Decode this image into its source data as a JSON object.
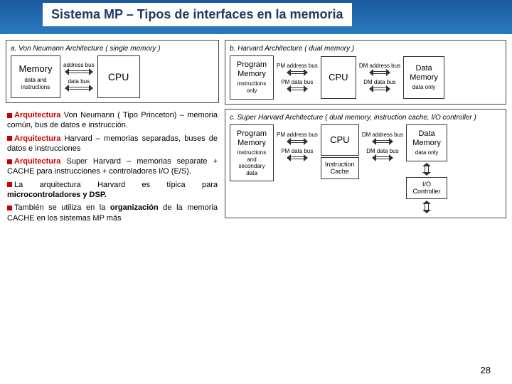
{
  "title": "Sistema MP  – Tipos de interfaces en la memoria",
  "diagA": {
    "label": "a.  Von Neumann Architecture  ( single memory )",
    "memory": "Memory",
    "memory_sub": "data and instructions",
    "cpu": "CPU",
    "bus1": "address bus",
    "bus2": "data bus"
  },
  "diagB": {
    "label": "b.  Harvard Architecture  ( dual memory )",
    "pmem": "Program Memory",
    "pmem_sub": "instructions only",
    "cpu": "CPU",
    "dmem": "Data Memory",
    "dmem_sub": "data only",
    "pm_addr": "PM address bus",
    "pm_data": "PM data bus",
    "dm_addr": "DM address bus",
    "dm_data": "DM data bus"
  },
  "diagC": {
    "label": "c.  Super Harvard Architecture  ( dual memory, instruction cache, I/O controller )",
    "pmem": "Program Memory",
    "pmem_sub": "instructions and secondary data",
    "cpu": "CPU",
    "cache": "Instruction Cache",
    "dmem": "Data Memory",
    "dmem_sub": "data only",
    "io": "I/O Controller",
    "pm_addr": "PM address bus",
    "pm_data": "PM data bus",
    "dm_addr": "DM address bus",
    "dm_data": "DM data bus"
  },
  "bullets": {
    "b1a": "Arquitectura",
    "b1b": " Von Neumann ( Tipo Princeton) – memoria común, bus de datos e instrucción.",
    "b2a": "Arquitectura",
    "b2b": " Harvard – memorias separadas, buses de datos e instrucciones",
    "b3a": "Arquitectura",
    "b3b": " Super Harvard – memorias separate + CACHE para instrucciones + controladores I/O (E/S).",
    "b4": "La arquitectura Harvard es típica para ",
    "b4b": "microcontroladores y DSP.",
    "b5": "También se utiliza en la ",
    "b5b": "organización",
    "b5c": " de la ",
    "b5d": "memoria CACHE en los sistemas MP más"
  },
  "page": "28"
}
